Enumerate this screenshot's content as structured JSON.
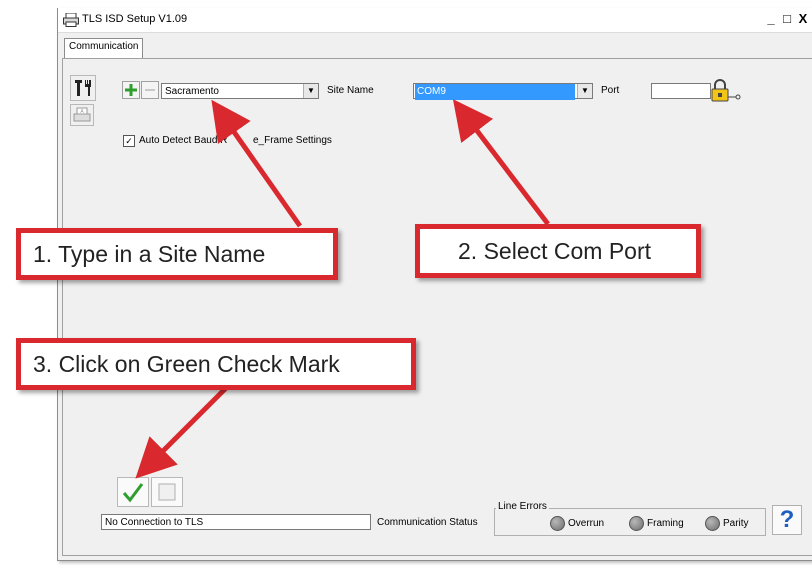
{
  "window": {
    "title": "TLS ISD Setup V1.09",
    "controls": {
      "minimize": "_",
      "maximize": "□",
      "close": "X"
    }
  },
  "tabs": [
    {
      "label": "Communication",
      "selected": true
    }
  ],
  "toolbar": {
    "tools_icon": "tools-icon",
    "print_icon": "printer-icon"
  },
  "site": {
    "add_icon": "plus-icon",
    "remove_icon": "minus-icon",
    "site_value": "Sacramento",
    "site_label": "Site Name",
    "port_value": "COM9",
    "port_label": "Port",
    "port_text": "",
    "lock_icon": "padlock-icon"
  },
  "auto_detect": {
    "checked": true,
    "label": "Auto Detect Baud Rate_Frame Settings",
    "visible_label_left": "Auto Detect Baud R",
    "visible_label_right": "e_Frame Settings"
  },
  "bottom": {
    "ok_icon": "green-check-icon",
    "cancel_icon": "blank-square-icon",
    "status_text": "No Connection to TLS",
    "status_label": "Communication Status",
    "line_errors_title": "Line Errors",
    "indicators": [
      "Overrun",
      "Framing",
      "Parity"
    ],
    "help": "?"
  },
  "callouts": {
    "c1": "1. Type in a Site Name",
    "c2": "2. Select Com Port",
    "c3": "3. Click on Green Check Mark"
  },
  "colors": {
    "arrow_red": "#d9292e",
    "selection_blue": "#3399ff",
    "check_green": "#2e9e2e",
    "help_blue": "#1f5fbf"
  }
}
